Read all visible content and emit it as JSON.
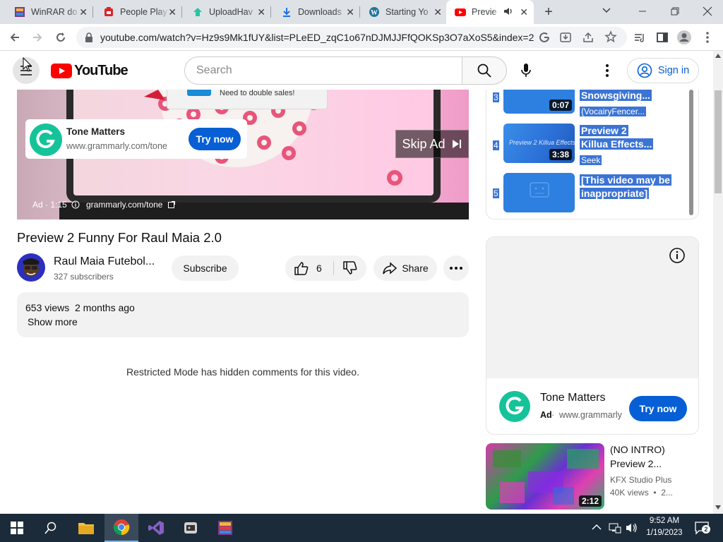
{
  "browser": {
    "tabs": [
      {
        "title": "WinRAR do",
        "icon": "winrar-icon"
      },
      {
        "title": "People Play",
        "icon": "rar-icon"
      },
      {
        "title": "UploadHav",
        "icon": "uploadhaven-icon"
      },
      {
        "title": "Downloads",
        "icon": "download-icon"
      },
      {
        "title": "Starting Yo",
        "icon": "wordpress-icon"
      },
      {
        "title": "Previe",
        "icon": "youtube-icon"
      }
    ],
    "url": "youtube.com/watch?v=Hz9s9Mk1fUY&list=PLeED_zqC1o67nDJMJJFfQOKSp3O7aXoS5&index=2"
  },
  "header": {
    "logo_text": "YouTube",
    "search_placeholder": "Search",
    "signin_label": "Sign in"
  },
  "ad": {
    "popup_text": "Need to double sales!",
    "brand": "Tone Matters",
    "url": "www.grammarly.com/tone",
    "try_label": "Try now",
    "skip_label": "Skip Ad",
    "ad_info": "Ad · 1:15",
    "bottom_url": "grammarly.com/tone"
  },
  "video": {
    "title": "Preview 2 Funny For Raul Maia 2.0",
    "channel": "Raul Maia Futebol...",
    "subscribers": "327 subscribers",
    "subscribe_label": "Subscribe",
    "likes": "6",
    "share_label": "Share",
    "views": "653 views",
    "date": "2 months ago",
    "show_more": "Show more",
    "comments_note": "Restricted Mode has hidden comments for this video."
  },
  "playlist": [
    {
      "num": "3",
      "title": "Snowsgiving...",
      "author": "{VocairyFencer...",
      "duration": "0:07"
    },
    {
      "num": "4",
      "title": "Preview 2 Killua Effects...",
      "title_line1": "Preview 2",
      "title_line2": "Killua Effects...",
      "author": "Seek",
      "duration": "3:38",
      "thumb_text": "Preview 2 Killua Effects"
    },
    {
      "num": "5",
      "title_line1": "[This video may be",
      "title_line2": "inappropriate]"
    }
  ],
  "side_ad": {
    "brand": "Tone Matters",
    "ad_label": "Ad",
    "url": "www.grammarly",
    "try_label": "Try now"
  },
  "recommended": {
    "title_line1": "(NO INTRO)",
    "title_line2": "Preview 2...",
    "channel": "KFX Studio Plus",
    "meta": "40K views  •  2...",
    "duration": "2:12"
  },
  "taskbar": {
    "time": "9:52 AM",
    "date": "1/19/2023",
    "notifications": "2"
  }
}
